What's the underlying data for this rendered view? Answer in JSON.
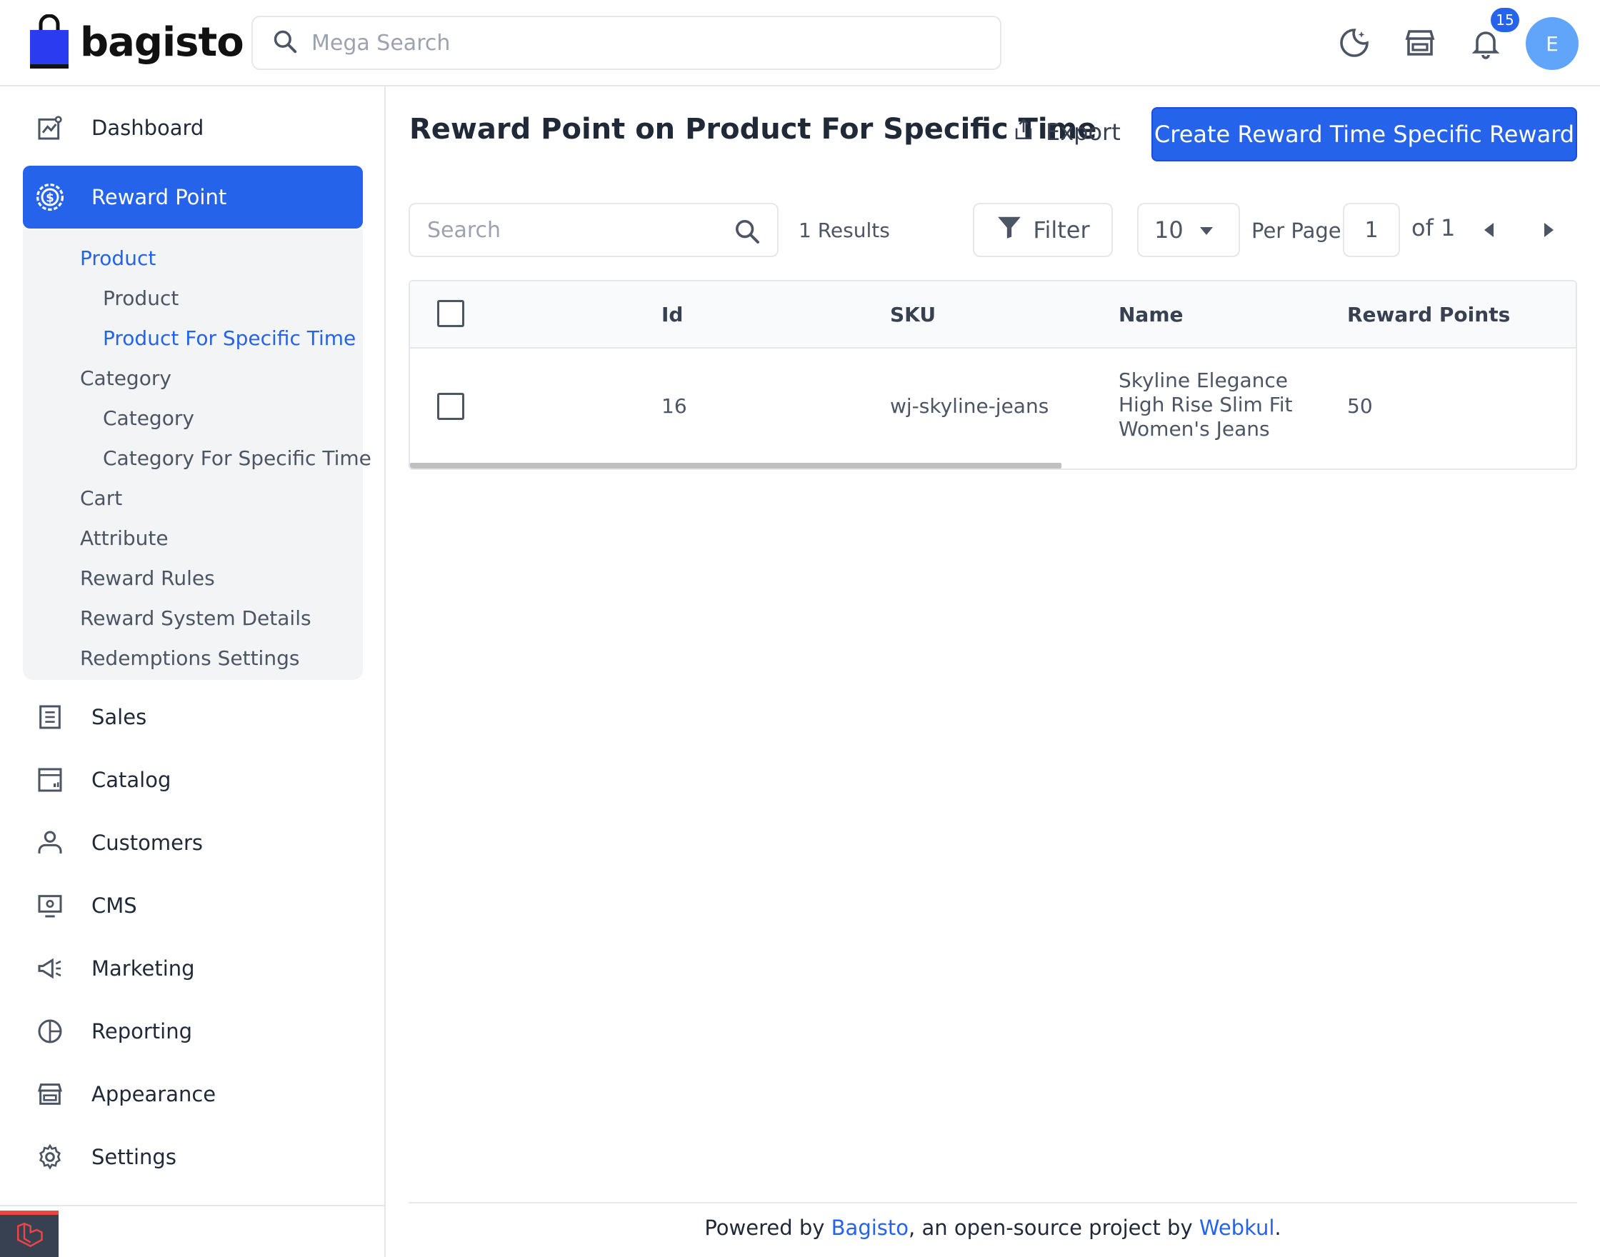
{
  "header": {
    "brand": "bagisto",
    "search_placeholder": "Mega Search",
    "notification_count": "15",
    "avatar_initial": "E"
  },
  "sidebar": {
    "items": [
      {
        "label": "Dashboard",
        "icon": "dashboard-icon"
      },
      {
        "label": "Reward Point",
        "icon": "reward-point-icon",
        "active": true
      },
      {
        "label": "Sales",
        "icon": "sales-icon"
      },
      {
        "label": "Catalog",
        "icon": "catalog-icon"
      },
      {
        "label": "Customers",
        "icon": "customers-icon"
      },
      {
        "label": "CMS",
        "icon": "cms-icon"
      },
      {
        "label": "Marketing",
        "icon": "marketing-icon"
      },
      {
        "label": "Reporting",
        "icon": "reporting-icon"
      },
      {
        "label": "Appearance",
        "icon": "appearance-icon"
      },
      {
        "label": "Settings",
        "icon": "settings-icon"
      }
    ],
    "submenu": [
      {
        "label": "Product",
        "level": 1,
        "active": true
      },
      {
        "label": "Product",
        "level": 2
      },
      {
        "label": "Product For Specific Time",
        "level": 2,
        "active": true
      },
      {
        "label": "Category",
        "level": 1
      },
      {
        "label": "Category",
        "level": 2
      },
      {
        "label": "Category For Specific Time",
        "level": 2
      },
      {
        "label": "Cart",
        "level": 1
      },
      {
        "label": "Attribute",
        "level": 1
      },
      {
        "label": "Reward Rules",
        "level": 1
      },
      {
        "label": "Reward System Details",
        "level": 1
      },
      {
        "label": "Redemptions Settings",
        "level": 1
      }
    ]
  },
  "main": {
    "title": "Reward Point on Product For Specific Time",
    "export_label": "Export",
    "create_label": "Create Reward Time Specific Reward",
    "grid_search_placeholder": "Search",
    "results_text": "1 Results",
    "filter_label": "Filter",
    "per_page_value": "10",
    "per_page_label": "Per Page",
    "current_page": "1",
    "page_of": "of 1",
    "table": {
      "columns": [
        "Id",
        "SKU",
        "Name",
        "Reward Points"
      ],
      "rows": [
        {
          "id": "16",
          "sku": "wj-skyline-jeans",
          "name": "Skyline Elegance High Rise Slim Fit Women's Jeans",
          "reward_points": "50"
        }
      ]
    }
  },
  "footer": {
    "prefix": "Powered by ",
    "link1": "Bagisto",
    "middle": ", an open-source project by ",
    "link2": "Webkul",
    "suffix": "."
  },
  "colors": {
    "accent": "#2563eb",
    "border": "#e5e7eb",
    "submenu_bg": "#f3f4f6"
  }
}
